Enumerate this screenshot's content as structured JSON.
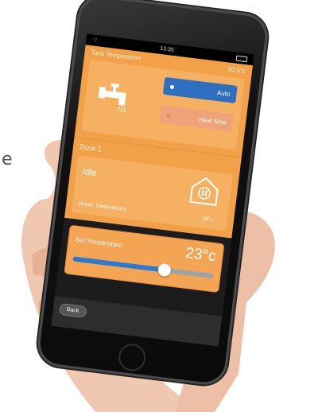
{
  "status_bar": {
    "time": "13:35"
  },
  "tank": {
    "title": "Tank Temperature",
    "value": "50.5°c",
    "auto_label": "Auto",
    "heat_now_label": "Heat Now"
  },
  "zone": {
    "title": "Zone 1",
    "state": "Idle",
    "room_temp_label": "Room Temperature",
    "room_temp_value": "18°c"
  },
  "set_temp": {
    "label": "Set Temperature",
    "value": "23°c",
    "slider_fraction": 0.65
  },
  "nav": {
    "back_label": "Back"
  },
  "background": {
    "letter": "e"
  },
  "colors": {
    "orange": "#f2a149",
    "blue": "#2e6fc2",
    "heat_button": "#f0a37a"
  }
}
